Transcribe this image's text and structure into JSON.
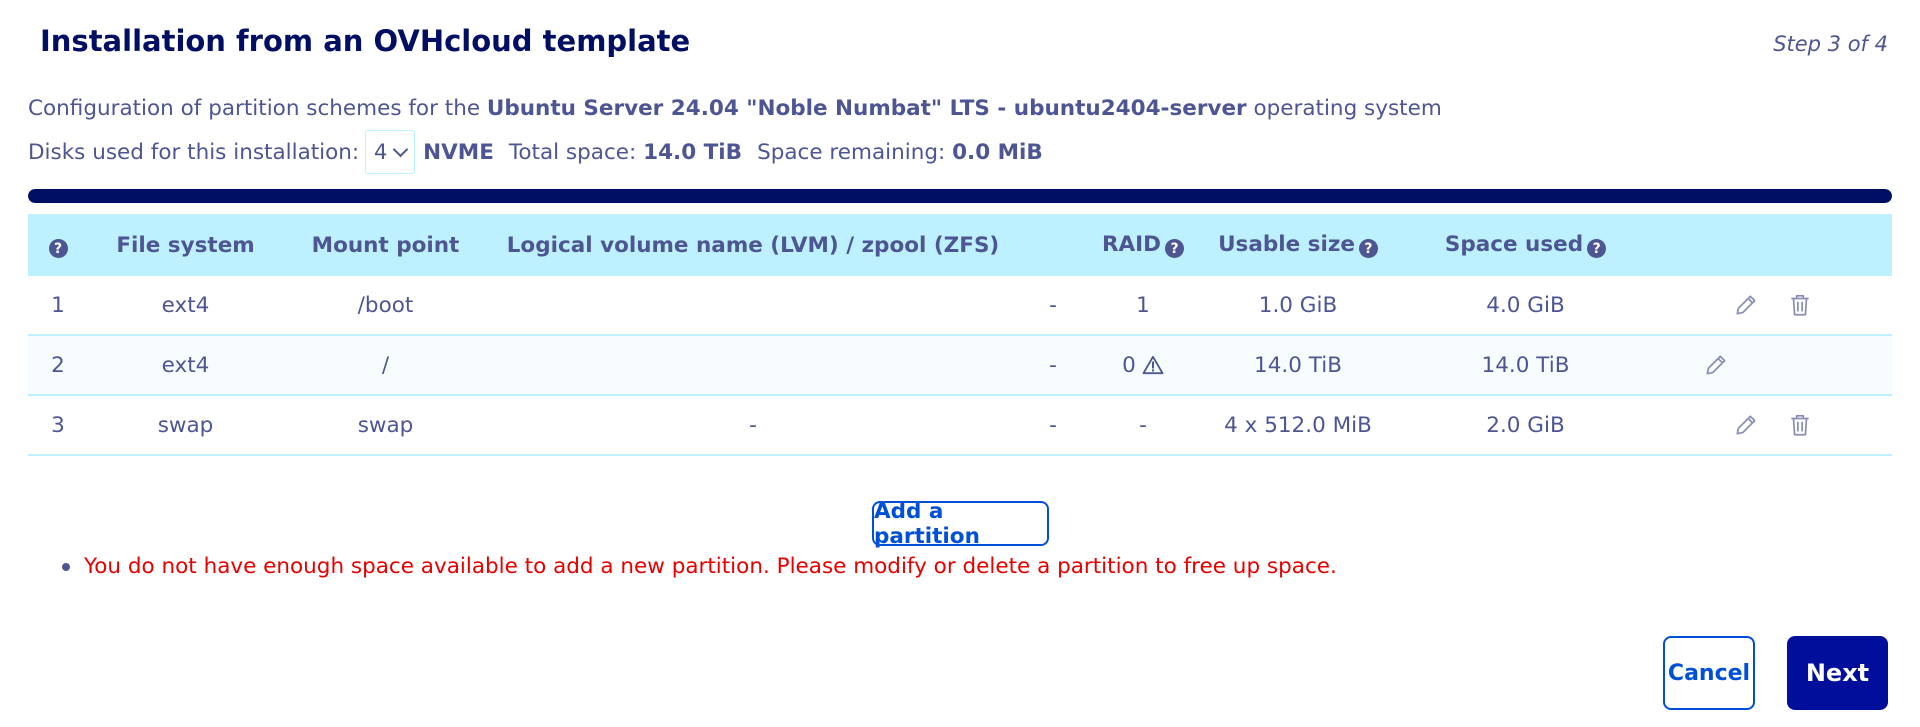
{
  "header": {
    "title": "Installation from an OVHcloud template",
    "step": "Step 3 of 4"
  },
  "config": {
    "prefix": "Configuration of partition schemes for the ",
    "os_name": "Ubuntu Server 24.04 \"Noble Numbat\" LTS - ubuntu2404-server",
    "suffix": " operating system"
  },
  "disks": {
    "label": "Disks used for this installation:",
    "count_selected": "4",
    "type": "NVME",
    "total_label": "Total space:",
    "total_value": "14.0 TiB",
    "remaining_label": "Space remaining:",
    "remaining_value": "0.0 MiB"
  },
  "usage_fraction": 1.0,
  "colors": {
    "title": "#000e64",
    "text": "#4d5693",
    "header_bg": "#bef1ff",
    "primary": "#0050d7",
    "next_bg": "#000e9c",
    "error": "#e80000"
  },
  "table": {
    "help_icon": "question-circle-icon",
    "headers": {
      "filesystem": "File system",
      "mount": "Mount point",
      "volume": "Logical volume name (LVM) / zpool (ZFS)",
      "raid": "RAID",
      "usable": "Usable size",
      "used": "Space used"
    },
    "rows": [
      {
        "index": "1",
        "filesystem": "ext4",
        "mount": "/boot",
        "volume": "",
        "dash": "-",
        "raid": "1",
        "usable": "1.0 GiB",
        "used": "4.0 GiB",
        "deletable": true,
        "warning": false
      },
      {
        "index": "2",
        "filesystem": "ext4",
        "mount": "/",
        "volume": "",
        "dash": "-",
        "raid": "0",
        "usable": "14.0 TiB",
        "used": "14.0 TiB",
        "deletable": false,
        "warning": true
      },
      {
        "index": "3",
        "filesystem": "swap",
        "mount": "swap",
        "volume": "-",
        "dash": "-",
        "raid": "-",
        "usable": "4 x 512.0 MiB",
        "used": "2.0 GiB",
        "deletable": true,
        "warning": false
      }
    ]
  },
  "add_partition_label": "Add a partition",
  "error_message": "You do not have enough space available to add a new partition. Please modify or delete a partition to free up space.",
  "buttons": {
    "cancel": "Cancel",
    "next": "Next"
  }
}
